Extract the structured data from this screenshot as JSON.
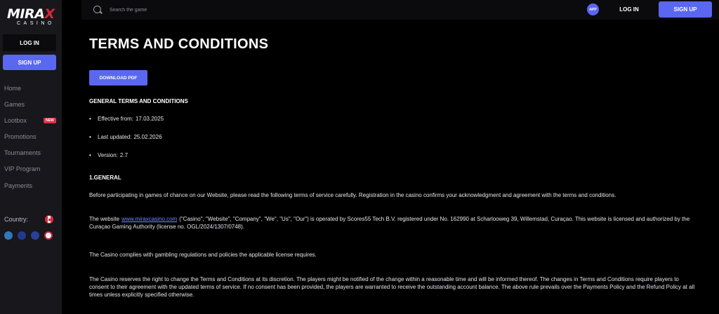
{
  "brand": {
    "logo_main": "MIRAX",
    "logo_sub": "CASINO"
  },
  "sidebar": {
    "login_label": "LOG IN",
    "signup_label": "SIGN UP",
    "items": [
      {
        "label": "Home"
      },
      {
        "label": "Games"
      },
      {
        "label": "Lootbox",
        "badge": "NEW"
      },
      {
        "label": "Promotions"
      },
      {
        "label": "Tournaments"
      },
      {
        "label": "VIP Program"
      },
      {
        "label": "Payments"
      }
    ],
    "country_label": "Country:"
  },
  "header": {
    "search_placeholder": "Search the game",
    "app_label": "APP",
    "login_label": "LOG IN",
    "signup_label": "SIGN UP"
  },
  "main": {
    "title": "TERMS AND CONDITIONS",
    "download_label": "DOWNLOAD PDF",
    "general_title": "GENERAL TERMS AND CONDITIONS",
    "meta": [
      {
        "label": "Effective from:",
        "value": "17.03.2025"
      },
      {
        "label": "Last updated:",
        "value": "25.02.2026"
      },
      {
        "label": "Version:",
        "value": "2.7"
      }
    ],
    "section1_title": "1.GENERAL",
    "p1": "Before participating in games of chance on our Website, please read the following terms of service carefully. Registration in the casino confirms your acknowledgment and agreement with the terms and conditions.",
    "p2_prefix": "The website",
    "p2_link": "www.miraxcasino.com",
    "p2_suffix": "(\"Casino\", \"Website\", \"Company\", \"We\", \"Us\", \"Our\") is operated by Scores55 Tech B.V. registered under No. 162990 at Scharlooweg 39, Willemstad, Curaçao. This website is licensed and authorized by the Curaçao Gaming Authority (license no. OGL/2024/1307/0748).",
    "p3": "The Casino complies with gambling regulations and policies the applicable license requires.",
    "p4": "The Casino reserves the right to change the Terms and Conditions at its discretion. The players might be notified of the change within a reasonable time and will be informed thereof. The changes in Terms and Conditions require players to consent to their agreement with the updated terms of service. If no consent has been provided, the players are warranted to receive the outstanding account balance. The above rule prevails over the Payments Policy and the Refund Policy at all times unless explicitly specified otherwise."
  },
  "colors": {
    "accent": "#5a67f0",
    "sidebar_bg": "#17171c",
    "badge_red": "#e0304a"
  }
}
